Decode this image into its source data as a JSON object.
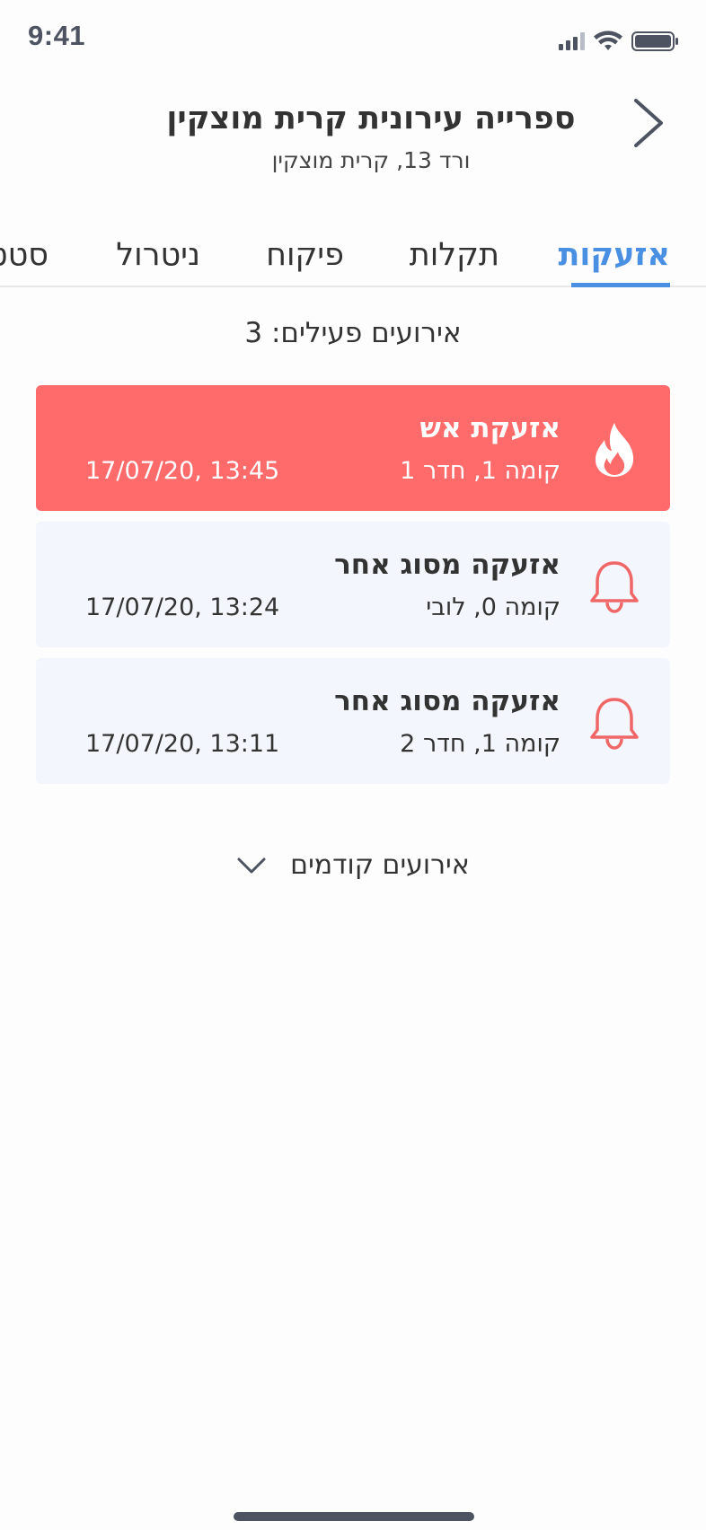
{
  "status_bar": {
    "time": "9:41",
    "signal_icon": "signal-icon",
    "wifi_icon": "wifi-icon",
    "battery_icon": "battery-icon"
  },
  "header": {
    "back_icon": "chevron-right-icon",
    "title": "ספרייה עירונית קרית מוצקין",
    "subtitle": "ורד 13, קרית מוצקין"
  },
  "tabs": {
    "items": [
      {
        "label": "אזעקות",
        "active": true
      },
      {
        "label": "תקלות",
        "active": false
      },
      {
        "label": "פיקוח",
        "active": false
      },
      {
        "label": "ניטרול",
        "active": false
      },
      {
        "label": "סטטוס",
        "active": false
      }
    ]
  },
  "events": {
    "count_label": "אירועים פעילים: 3",
    "items": [
      {
        "icon": "fire-icon",
        "title": "אזעקת אש",
        "location": "קומה 1, חדר 1",
        "time": "17/07/20, 13:45",
        "highlight": true
      },
      {
        "icon": "bell-icon",
        "title": "אזעקה מסוג אחר",
        "location": "קומה 0, לובי",
        "time": "17/07/20, 13:24",
        "highlight": false
      },
      {
        "icon": "bell-icon",
        "title": "אזעקה מסוג אחר",
        "location": "קומה 1, חדר 2",
        "time": "17/07/20, 13:11",
        "highlight": false
      }
    ],
    "previous_label": "אירועים קודמים",
    "previous_icon": "chevron-down-icon"
  },
  "colors": {
    "accent": "#4a90e2",
    "alert_bg": "#ff6b6b",
    "card_bg": "#f3f6fc",
    "bell": "#f06767",
    "icon_gray": "#4d5361"
  }
}
